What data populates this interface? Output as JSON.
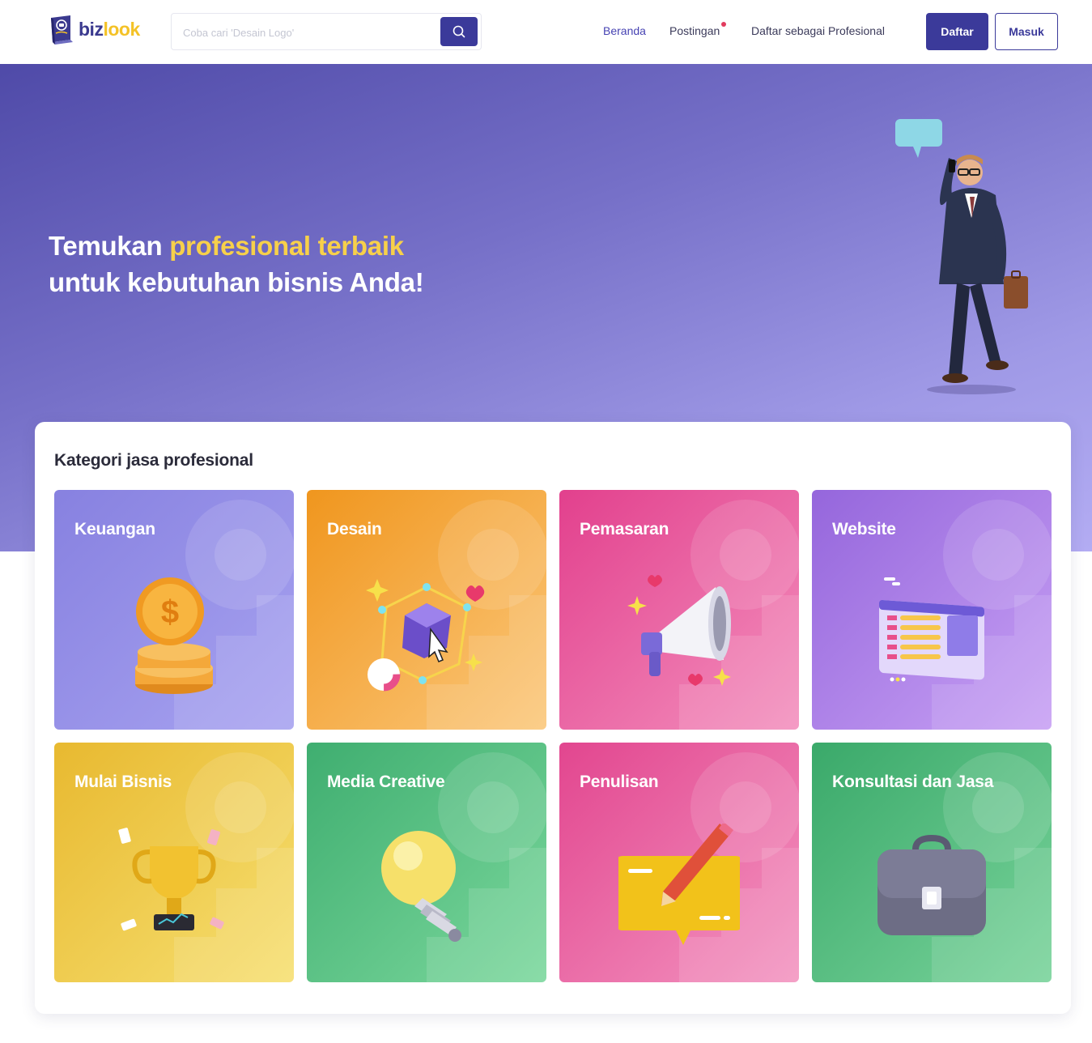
{
  "header": {
    "logo": {
      "part1": "biz",
      "part2": "look"
    },
    "search": {
      "placeholder": "Coba cari 'Desain Logo'"
    },
    "nav": [
      {
        "label": "Beranda"
      },
      {
        "label": "Postingan"
      },
      {
        "label": "Daftar sebagai Profesional"
      }
    ],
    "register_label": "Daftar",
    "login_label": "Masuk"
  },
  "hero": {
    "line1_a": "Temukan ",
    "line1_highlight": "profesional terbaik",
    "line2": "untuk kebutuhan bisnis Anda!"
  },
  "categories": {
    "title": "Kategori jasa profesional",
    "items": [
      {
        "label": "Keuangan",
        "icon": "coin-stack-icon",
        "color": "#8f89e6"
      },
      {
        "label": "Desain",
        "icon": "design-cube-icon",
        "color": "#f3a43a"
      },
      {
        "label": "Pemasaran",
        "icon": "megaphone-icon",
        "color": "#ea5c9f"
      },
      {
        "label": "Website",
        "icon": "browser-window-icon",
        "color": "#a37ae6"
      },
      {
        "label": "Mulai Bisnis",
        "icon": "trophy-icon",
        "color": "#eec94a"
      },
      {
        "label": "Media Creative",
        "icon": "lightbulb-icon",
        "color": "#52bb7f"
      },
      {
        "label": "Penulisan",
        "icon": "pencil-note-icon",
        "color": "#e9609f"
      },
      {
        "label": "Konsultasi dan Jasa",
        "icon": "briefcase-icon",
        "color": "#50b67d"
      }
    ]
  }
}
